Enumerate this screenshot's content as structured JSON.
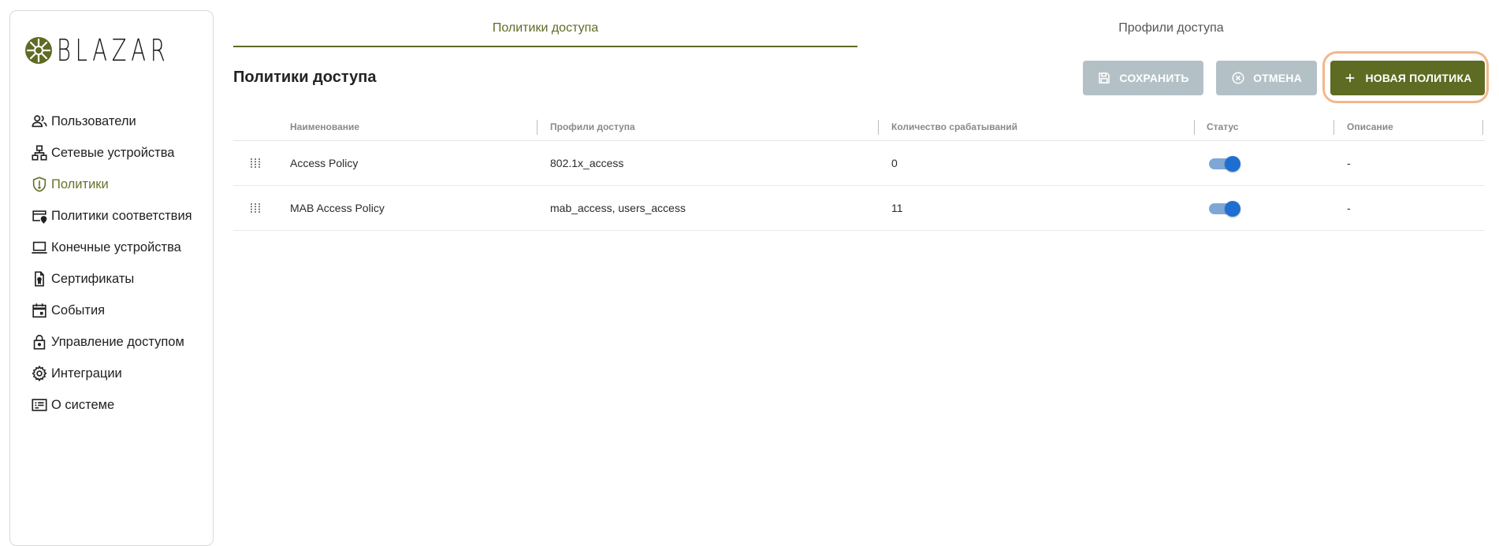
{
  "app": {
    "logo_text": "BLAZAR"
  },
  "sidebar": {
    "items": [
      {
        "label": "Пользователи",
        "icon": "users-icon",
        "active": false
      },
      {
        "label": "Сетевые устройства",
        "icon": "network-icon",
        "active": false
      },
      {
        "label": "Политики",
        "icon": "shield-alert-icon",
        "active": true
      },
      {
        "label": "Политики соответствия",
        "icon": "card-location-icon",
        "active": false
      },
      {
        "label": "Конечные устройства",
        "icon": "laptop-icon",
        "active": false
      },
      {
        "label": "Сертификаты",
        "icon": "certificate-icon",
        "active": false
      },
      {
        "label": "События",
        "icon": "calendar-icon",
        "active": false
      },
      {
        "label": "Управление доступом",
        "icon": "lock-icon",
        "active": false
      },
      {
        "label": "Интеграции",
        "icon": "gear-icon",
        "active": false
      },
      {
        "label": "О системе",
        "icon": "info-list-icon",
        "active": false
      }
    ]
  },
  "tabs": [
    {
      "label": "Политики доступа",
      "active": true
    },
    {
      "label": "Профили доступа",
      "active": false
    }
  ],
  "main": {
    "title": "Политики доступа",
    "buttons": {
      "save": "СОХРАНИТЬ",
      "cancel": "ОТМЕНА",
      "new": "НОВАЯ ПОЛИТИКА"
    }
  },
  "table": {
    "columns": [
      "Наименование",
      "Профили доступа",
      "Количество срабатываний",
      "Статус",
      "Описание"
    ],
    "rows": [
      {
        "name": "Access Policy",
        "profiles": "802.1x_access",
        "count": "0",
        "status": true,
        "description": "-"
      },
      {
        "name": "MAB Access Policy",
        "profiles": "mab_access, users_access",
        "count": "11",
        "status": true,
        "description": "-"
      }
    ]
  },
  "colors": {
    "accent": "#5e6b22",
    "disabled_button": "#b3c1c7",
    "toggle_on": "#1e6fd1",
    "highlight_ring": "#f3b78a"
  }
}
